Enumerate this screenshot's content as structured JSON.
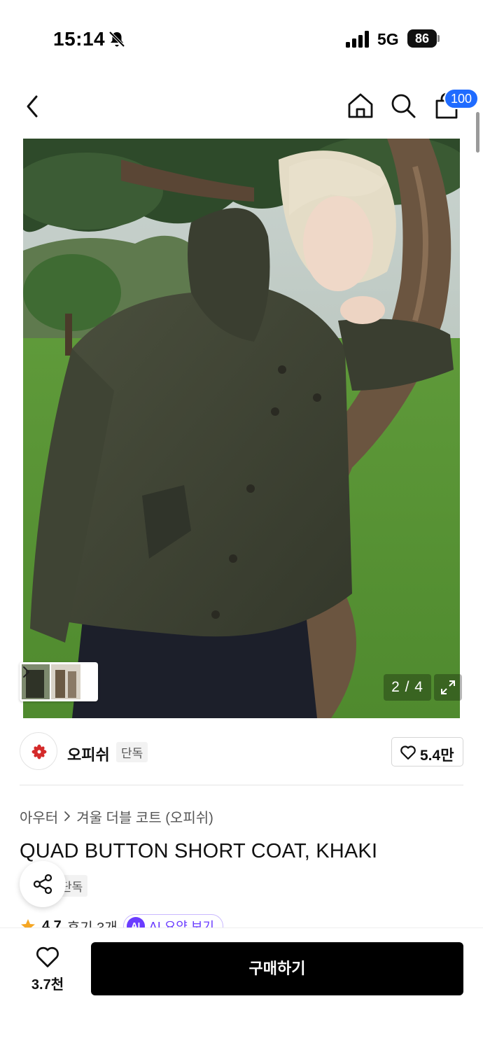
{
  "status_bar": {
    "time": "15:14",
    "network": "5G",
    "battery": "86",
    "icons": [
      "bell-muted-icon",
      "signal-icon",
      "battery-icon"
    ]
  },
  "nav": {
    "icons": [
      "back-icon",
      "home-icon",
      "search-icon",
      "bag-icon"
    ],
    "cart_count": "100"
  },
  "gallery": {
    "counter": "2 / 4",
    "image_description_icon": "product-photo",
    "expand_icon": "expand-icon"
  },
  "brand": {
    "name": "오피쉬",
    "tag": "단독",
    "like_count": "5.4만"
  },
  "product": {
    "breadcrumb": [
      "아우터",
      "겨울 더블 코트 (오피쉬)"
    ],
    "title": "QUAD BUTTON SHORT COAT, KHAKI",
    "exclusive_tag": "단독",
    "rating": "4.7",
    "reviews": "후기 3개",
    "ai_badge": "AI",
    "ai_summary": "AI 요약 보기"
  },
  "bottom": {
    "wish_count": "3.7천",
    "buy_label": "구매하기"
  },
  "colors": {
    "accent_blue": "#1f6bff",
    "brand_red": "#d42a2a",
    "ai_purple": "#6a3cff",
    "rating_star": "#f5a623"
  }
}
